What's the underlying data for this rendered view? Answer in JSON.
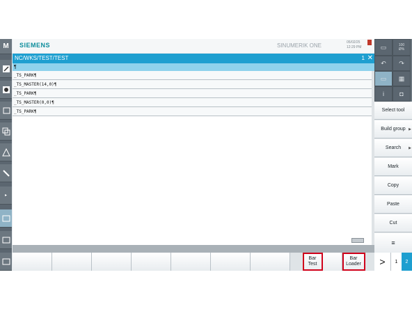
{
  "header": {
    "brand": "SIEMENS",
    "product": "SINUMERIK ONE",
    "date": "05/02/25",
    "time": "12:29 PM"
  },
  "path": {
    "title": "NC/WKS/TEST/TEST",
    "channel": "1",
    "close": "✕"
  },
  "editor": {
    "first_line": "¶",
    "lines": [
      "_TS_PARK¶",
      "_TS_MASTER(14,0)¶",
      "_TS_PARK¶",
      "_TS_MASTER(0,0)¶",
      "_TS_PARK¶"
    ]
  },
  "left_bar": {
    "top_label": "M"
  },
  "right_top": {
    "counter": "100",
    "sub": "Ø%"
  },
  "right_softkeys": [
    {
      "label": "Select tool",
      "arrow": ""
    },
    {
      "label": "Build group",
      "arrow": "▶"
    },
    {
      "label": "Search",
      "arrow": "▶"
    },
    {
      "label": "Mark",
      "arrow": ""
    },
    {
      "label": "Copy",
      "arrow": ""
    },
    {
      "label": "Paste",
      "arrow": ""
    },
    {
      "label": "Cut",
      "arrow": ""
    }
  ],
  "bottom_softkeys": [
    {
      "label": ""
    },
    {
      "label": ""
    },
    {
      "label": ""
    },
    {
      "label": ""
    },
    {
      "label": ""
    },
    {
      "label": ""
    },
    {
      "label": ""
    },
    {
      "label": "Bar Test"
    },
    {
      "label": "Bar Loader"
    }
  ],
  "paging": {
    "more": ">",
    "page1": "1",
    "page2": "2"
  },
  "colors": {
    "accent": "#1e9fd0",
    "highlight": "#d0021b",
    "brand": "#0b8c9b"
  }
}
